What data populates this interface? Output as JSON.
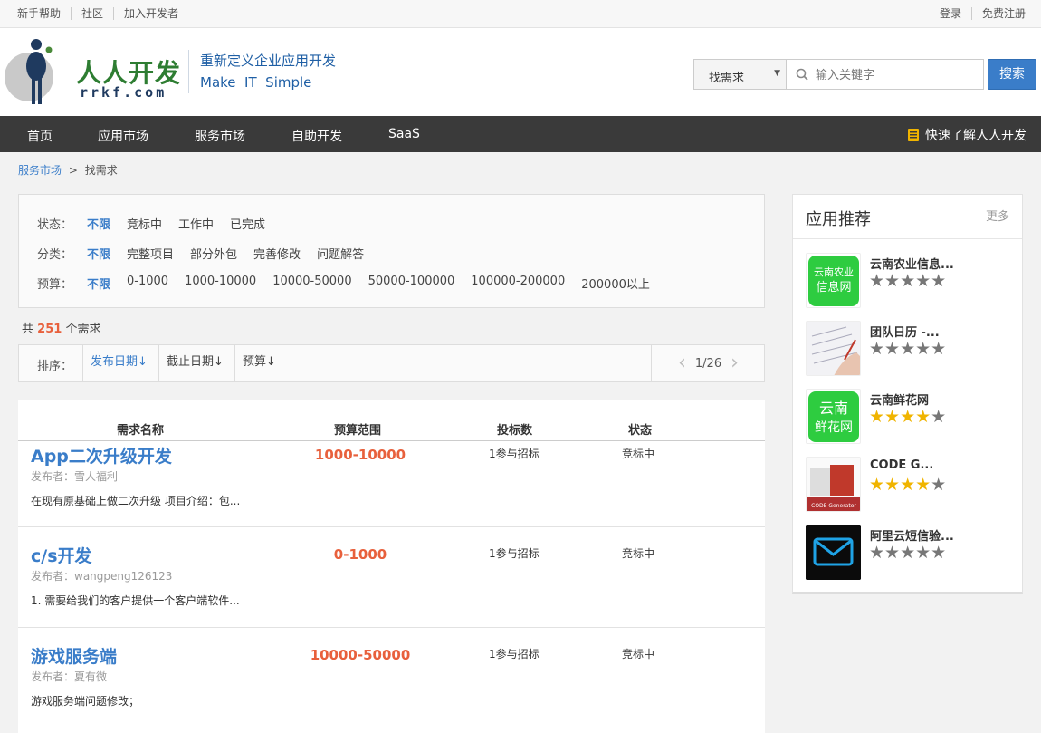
{
  "topbar": {
    "links_left": [
      "新手帮助",
      "社区",
      "加入开发者"
    ],
    "links_right": [
      "登录",
      "免费注册"
    ]
  },
  "header": {
    "logo_name": "人人开发",
    "logo_domain": "rrkf.com",
    "slogan_line1": "重新定义企业应用开发",
    "slogan_line2": "Make  IT  Simple",
    "search_type": "找需求",
    "search_placeholder": "输入关键字",
    "search_button": "搜索"
  },
  "nav": {
    "items": [
      "首页",
      "应用市场",
      "服务市场",
      "自助开发",
      "SaaS"
    ],
    "quick": "快速了解人人开发"
  },
  "breadcrumb": {
    "root": "服务市场",
    "sep": ">",
    "current": "找需求"
  },
  "filters": {
    "status": {
      "label": "状态：",
      "options": [
        "不限",
        "竞标中",
        "工作中",
        "已完成"
      ],
      "selected": "不限"
    },
    "category": {
      "label": "分类：",
      "options": [
        "不限",
        "完整项目",
        "部分外包",
        "完善修改",
        "问题解答"
      ],
      "selected": "不限"
    },
    "budget": {
      "label": "预算：",
      "options": [
        "不限",
        "0-1000",
        "1000-10000",
        "10000-50000",
        "50000-100000",
        "100000-200000",
        "200000以上"
      ],
      "selected": "不限"
    }
  },
  "count": {
    "prefix": "共",
    "num": "251",
    "suffix": "个需求"
  },
  "sort": {
    "label": "排序：",
    "options": [
      "发布日期",
      "截止日期",
      "预算"
    ],
    "selected": "发布日期",
    "arrow": "↓"
  },
  "pager": {
    "text": "1/26",
    "prev": "‹",
    "next": "›"
  },
  "list": {
    "headers": [
      "需求名称",
      "预算范围",
      "投标数",
      "状态"
    ],
    "rows": [
      {
        "title": "App二次升级开发",
        "publisher": "发布者：雪人福利",
        "desc": "在现有原基础上做二次升级 项目介绍：包...",
        "budget": "1000-10000",
        "bids": "1参与招标",
        "status": "竞标中"
      },
      {
        "title": "c/s开发",
        "publisher": "发布者：wangpeng126123",
        "desc": "1. 需要给我们的客户提供一个客户端软件...",
        "budget": "0-1000",
        "bids": "1参与招标",
        "status": "竞标中"
      },
      {
        "title": "游戏服务端",
        "publisher": "发布者：夏有微",
        "desc": "游戏服务端问题修改；",
        "budget": "10000-50000",
        "bids": "1参与招标",
        "status": "竞标中"
      }
    ]
  },
  "sidebar": {
    "title": "应用推荐",
    "more": "更多",
    "apps": [
      {
        "name": "云南农业信息...",
        "rating": 0,
        "thumb_text": "云南农业信息网"
      },
      {
        "name": "团队日历 -...",
        "rating": 0,
        "thumb_text": ""
      },
      {
        "name": "云南鲜花网",
        "rating": 4,
        "thumb_text": "云南鲜花网"
      },
      {
        "name": "CODE G...",
        "rating": 4,
        "thumb_text": "CODE Generator"
      },
      {
        "name": "阿里云短信验...",
        "rating": 0,
        "thumb_text": ""
      }
    ]
  },
  "colors": {
    "accent": "#3a7dc9",
    "price": "#e8603c",
    "nav_bg": "#3a3a3a",
    "star": "#f0b400"
  }
}
